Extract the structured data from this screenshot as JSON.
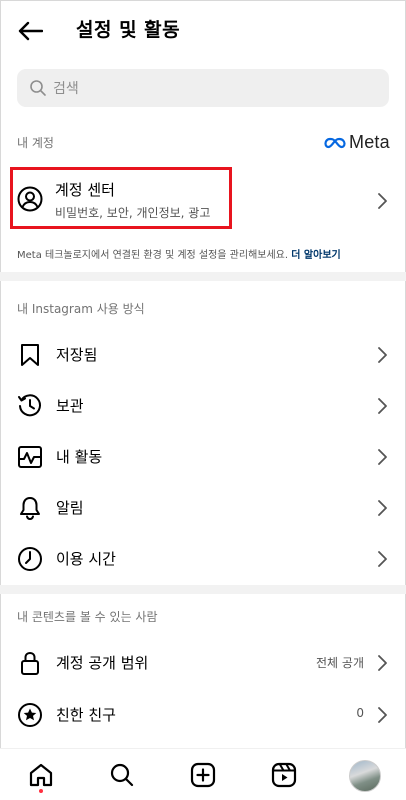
{
  "header": {
    "title": "설정 및 활동"
  },
  "search": {
    "placeholder": "검색"
  },
  "account_section": {
    "label": "내 계정",
    "meta_logo_text": "Meta",
    "account_center": {
      "title": "계정 센터",
      "subtitle": "비밀번호, 보안, 개인정보, 광고"
    },
    "note": "Meta 테크놀로지에서 연결된 환경 및 계정 설정을 관리해보세요.",
    "note_link": "더 알아보기"
  },
  "usage_section": {
    "label": "내 Instagram 사용 방식",
    "items": [
      {
        "label": "저장됨",
        "icon": "bookmark-icon"
      },
      {
        "label": "보관",
        "icon": "archive-icon"
      },
      {
        "label": "내 활동",
        "icon": "activity-icon"
      },
      {
        "label": "알림",
        "icon": "bell-icon"
      },
      {
        "label": "이용 시간",
        "icon": "clock-icon"
      }
    ]
  },
  "visibility_section": {
    "label": "내 콘텐츠를 볼 수 있는 사람",
    "items": [
      {
        "label": "계정 공개 범위",
        "value": "전체 공개",
        "icon": "lock-icon"
      },
      {
        "label": "친한 친구",
        "value": "0",
        "icon": "star-circle-icon"
      }
    ]
  },
  "bottom_nav": {
    "items": [
      "home-icon",
      "search-icon",
      "create-icon",
      "reels-icon",
      "profile-avatar"
    ],
    "notification_color": "#ff3040"
  },
  "colors": {
    "highlight": "#e8141e",
    "link": "#00376b",
    "meta_blue": "#0668e1"
  }
}
